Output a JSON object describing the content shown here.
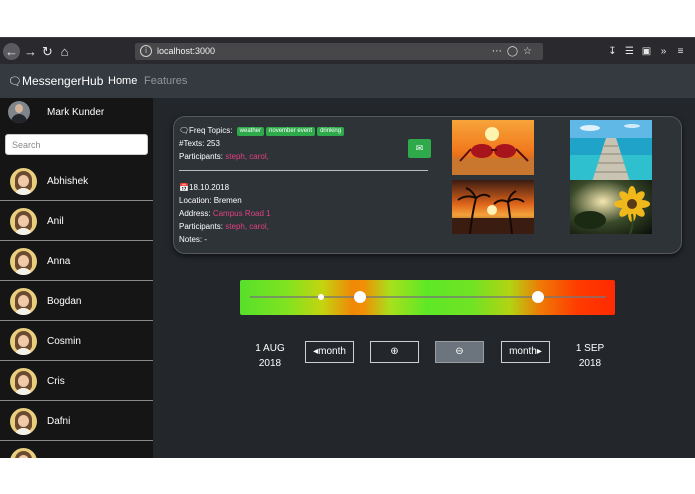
{
  "browser": {
    "url": "localhost:3000",
    "icons": [
      "back-arrow-icon",
      "forward-arrow-icon",
      "reload-icon",
      "home-icon",
      "info-icon",
      "more-icon",
      "pocket-icon",
      "star-icon",
      "download-icon",
      "library-icon",
      "sidebar-icon",
      "overflow-icon",
      "menu-icon"
    ]
  },
  "navbar": {
    "brand": "MessengerHub",
    "links": [
      "Home",
      "Features"
    ]
  },
  "sidebar": {
    "current_user": "Mark Kunder",
    "search_placeholder": "Search",
    "contacts": [
      "Abhishek",
      "Anil",
      "Anna",
      "Bogdan",
      "Cosmin",
      "Cris",
      "Dafni"
    ]
  },
  "card": {
    "freq_topics_label": "Freq Topics:",
    "topics": [
      "weather",
      "november event",
      "drinking"
    ],
    "texts": "#Texts: 253",
    "participants_label": "Participants:",
    "participants": "steph, carol,",
    "event_date": "18.10.2018",
    "location": "Location: Bremen",
    "address_label": "Address:",
    "address": "Campus Road 1",
    "event_participants_label": "Participants:",
    "event_participants": "steph, carol,",
    "notes": "Notes: -"
  },
  "photos": [
    "sunglasses-beach-photo",
    "pier-ocean-photo",
    "palm-sunset-photo",
    "sunflower-photo"
  ],
  "timeline": {
    "range_start_fraction": 0.31,
    "range_end_fraction": 0.81,
    "marker_fraction": 0.2
  },
  "controls": {
    "start_day": "1 AUG",
    "start_year": "2018",
    "prev_label": "month",
    "next_label": "month",
    "end_day": "1 SEP",
    "end_year": "2018"
  },
  "colors": {
    "accent_green": "#2eaa4a",
    "link_pink": "#e0427e"
  }
}
